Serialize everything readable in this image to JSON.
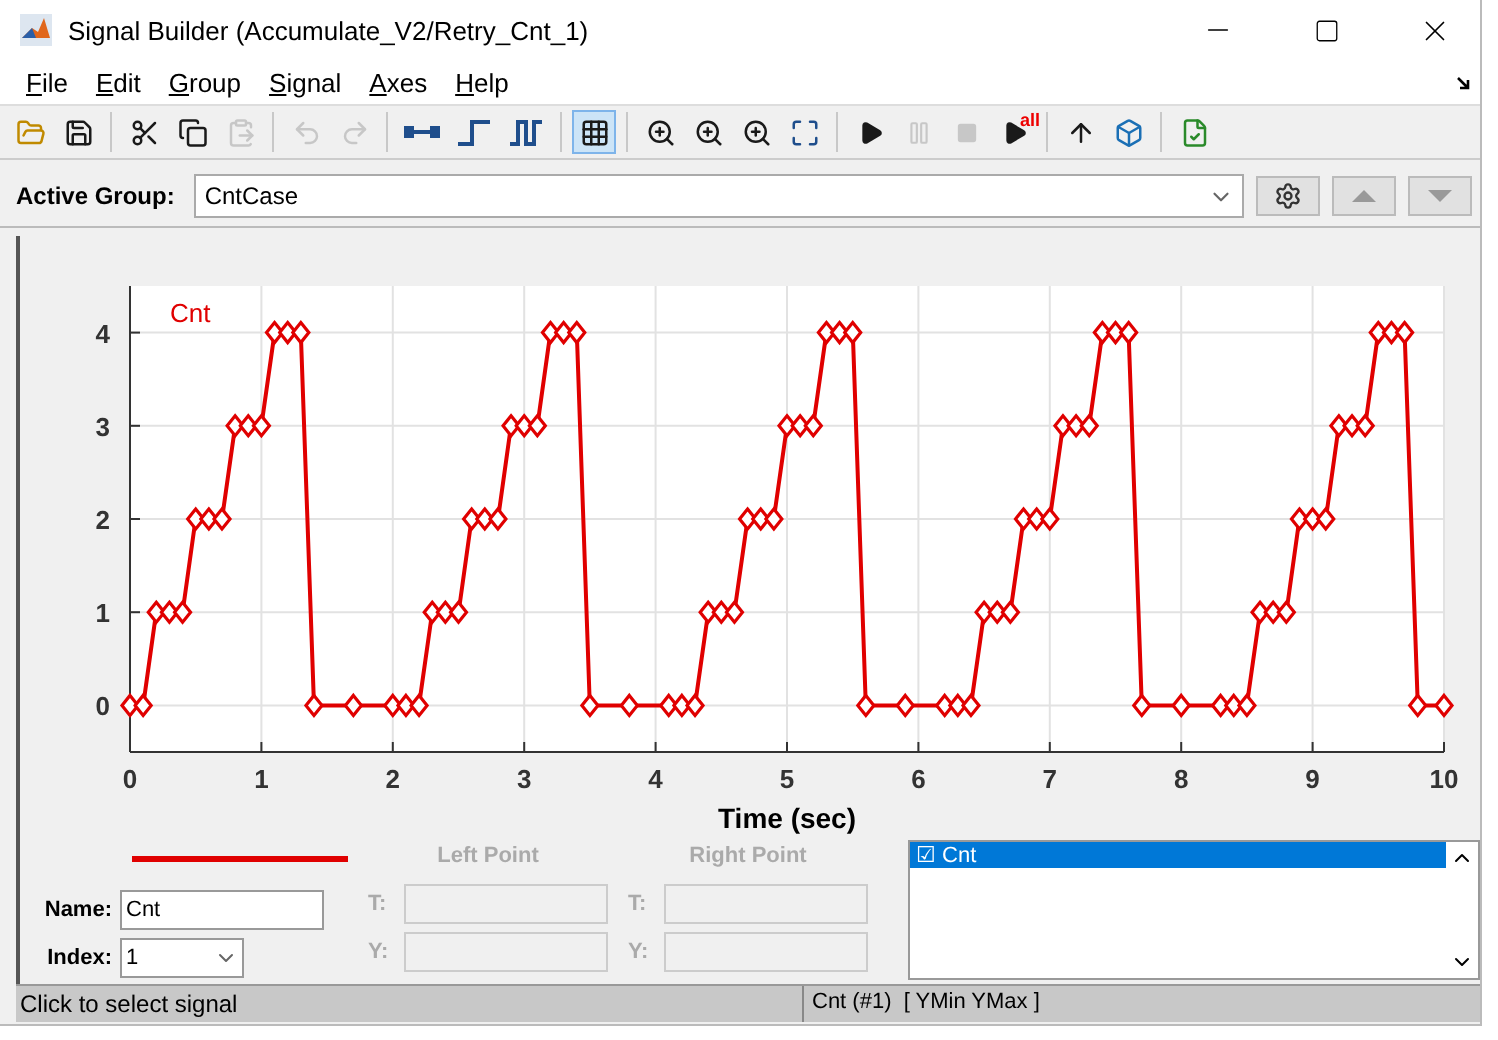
{
  "window": {
    "title": "Signal Builder (Accumulate_V2/Retry_Cnt_1)"
  },
  "menu": [
    "File",
    "Edit",
    "Group",
    "Signal",
    "Axes",
    "Help"
  ],
  "toolbar": [
    {
      "kind": "open",
      "disabled": false,
      "selected": false
    },
    {
      "kind": "save",
      "disabled": false,
      "selected": false
    },
    {
      "kind": "sep"
    },
    {
      "kind": "cut",
      "disabled": false,
      "selected": false
    },
    {
      "kind": "copy",
      "disabled": false,
      "selected": false
    },
    {
      "kind": "paste",
      "disabled": true,
      "selected": false
    },
    {
      "kind": "sep"
    },
    {
      "kind": "undo",
      "disabled": true,
      "selected": false
    },
    {
      "kind": "redo",
      "disabled": true,
      "selected": false
    },
    {
      "kind": "sep"
    },
    {
      "kind": "segment",
      "disabled": false,
      "selected": false
    },
    {
      "kind": "step",
      "disabled": false,
      "selected": false
    },
    {
      "kind": "pulse",
      "disabled": false,
      "selected": false
    },
    {
      "kind": "sep"
    },
    {
      "kind": "grid",
      "disabled": false,
      "selected": true
    },
    {
      "kind": "sep"
    },
    {
      "kind": "zoomx",
      "disabled": false,
      "selected": false
    },
    {
      "kind": "zoomy",
      "disabled": false,
      "selected": false
    },
    {
      "kind": "zoomxy",
      "disabled": false,
      "selected": false
    },
    {
      "kind": "fit",
      "disabled": false,
      "selected": false
    },
    {
      "kind": "sep"
    },
    {
      "kind": "play",
      "disabled": false,
      "selected": false
    },
    {
      "kind": "pause",
      "disabled": true,
      "selected": false
    },
    {
      "kind": "stop",
      "disabled": true,
      "selected": false
    },
    {
      "kind": "playall",
      "label": "all",
      "disabled": false,
      "selected": false
    },
    {
      "kind": "sep"
    },
    {
      "kind": "up",
      "disabled": false,
      "selected": false
    },
    {
      "kind": "model",
      "disabled": false,
      "selected": false
    },
    {
      "kind": "sep"
    },
    {
      "kind": "verify",
      "disabled": false,
      "selected": false
    }
  ],
  "active_group": {
    "label": "Active Group:",
    "value": "CntCase"
  },
  "group_buttons": [
    {
      "kind": "gear",
      "disabled": false
    },
    {
      "kind": "up",
      "disabled": true
    },
    {
      "kind": "down",
      "disabled": true
    }
  ],
  "chart": {
    "chart_data": {
      "type": "line",
      "grid": true,
      "marker": "diamond",
      "xlabel": "Time (sec)",
      "xlim": [
        0,
        10
      ],
      "ylim": [
        -0.5,
        4.5
      ],
      "xticks": [
        0,
        1,
        2,
        3,
        4,
        5,
        6,
        7,
        8,
        9,
        10
      ],
      "yticks": [
        0,
        1,
        2,
        3,
        4
      ],
      "x": [
        0,
        0.1,
        0.2,
        0.3,
        0.4,
        0.5,
        0.6,
        0.7,
        0.8,
        0.9,
        1.0,
        1.1,
        1.2,
        1.3,
        1.4,
        1.7,
        2.0,
        2.1,
        2.2,
        2.3,
        2.4,
        2.5,
        2.6,
        2.7,
        2.8,
        2.9,
        3.0,
        3.1,
        3.2,
        3.3,
        3.4,
        3.5,
        3.8,
        4.1,
        4.2,
        4.3,
        4.4,
        4.5,
        4.6,
        4.7,
        4.8,
        4.9,
        5.0,
        5.1,
        5.2,
        5.3,
        5.4,
        5.5,
        5.6,
        5.9,
        6.2,
        6.3,
        6.4,
        6.5,
        6.6,
        6.7,
        6.8,
        6.9,
        7.0,
        7.1,
        7.2,
        7.3,
        7.4,
        7.5,
        7.6,
        7.7,
        8.0,
        8.3,
        8.4,
        8.5,
        8.6,
        8.7,
        8.8,
        8.9,
        9.0,
        9.1,
        9.2,
        9.3,
        9.4,
        9.5,
        9.6,
        9.7,
        9.8,
        10.0
      ],
      "series": [
        {
          "name": "Cnt",
          "color": "#e00000",
          "values": [
            0,
            0,
            1,
            1,
            1,
            2,
            2,
            2,
            3,
            3,
            3,
            4,
            4,
            4,
            0,
            0,
            0,
            0,
            0,
            1,
            1,
            1,
            2,
            2,
            2,
            3,
            3,
            3,
            4,
            4,
            4,
            0,
            0,
            0,
            0,
            0,
            1,
            1,
            1,
            2,
            2,
            2,
            3,
            3,
            3,
            4,
            4,
            4,
            0,
            0,
            0,
            0,
            0,
            1,
            1,
            1,
            2,
            2,
            2,
            3,
            3,
            3,
            4,
            4,
            4,
            0,
            0,
            0,
            0,
            0,
            1,
            1,
            1,
            2,
            2,
            2,
            3,
            3,
            3,
            4,
            4,
            4,
            0,
            0
          ]
        }
      ]
    }
  },
  "signal_editor": {
    "name_label": "Name:",
    "name_value": "Cnt",
    "index_label": "Index:",
    "index_value": "1",
    "points": [
      {
        "header": "Left Point",
        "t_label": "T:",
        "y_label": "Y:"
      },
      {
        "header": "Right Point",
        "t_label": "T:",
        "y_label": "Y:"
      }
    ],
    "disabled": true
  },
  "signal_list": [
    {
      "label": "☑ Cnt",
      "selected": true
    }
  ],
  "status_bar": {
    "message": "Click to select signal",
    "signal_info": "Cnt (#1)  [ YMin YMax ]"
  }
}
